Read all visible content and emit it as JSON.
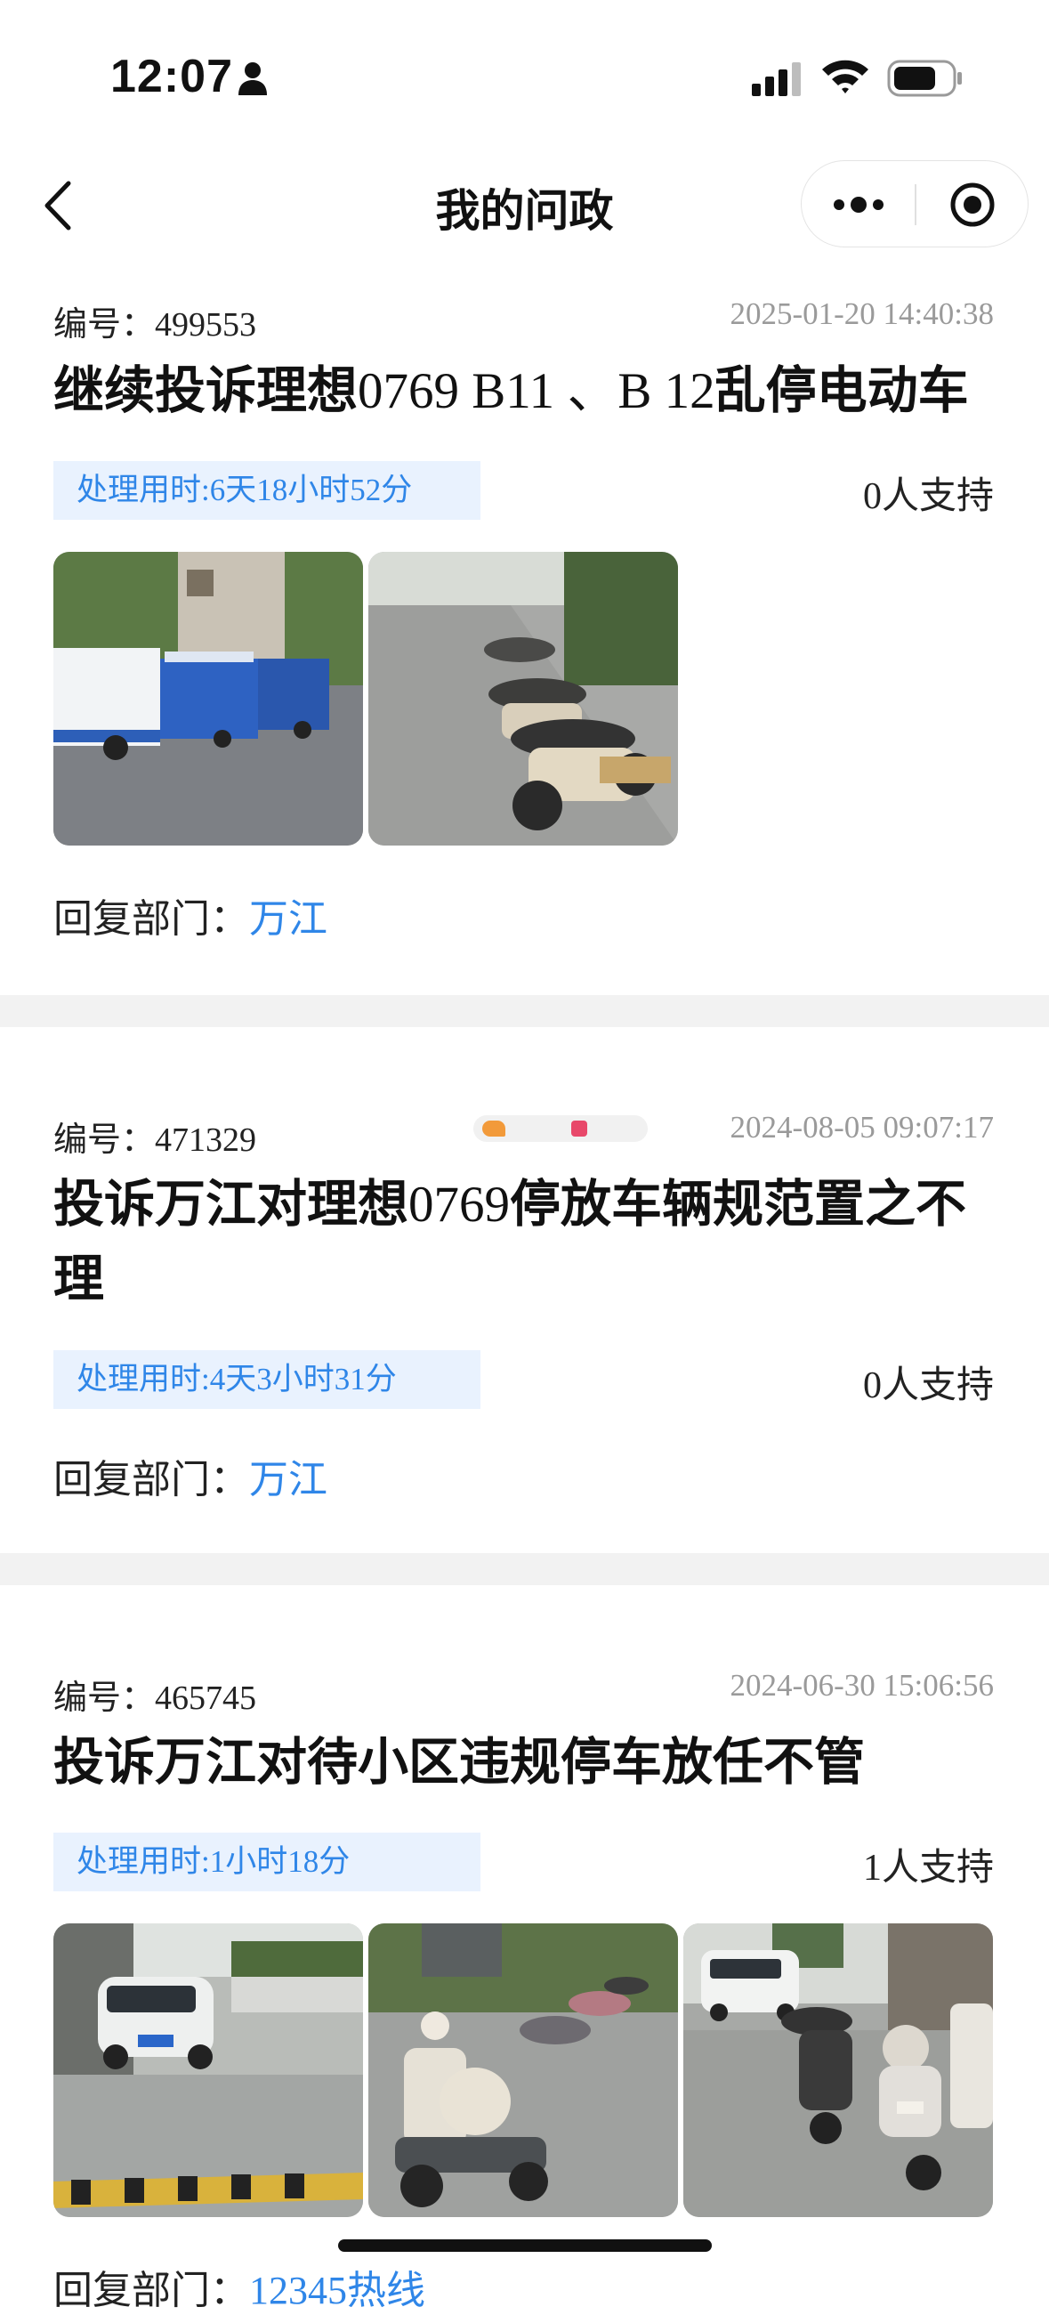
{
  "status_bar": {
    "time": "12:07"
  },
  "nav": {
    "title": "我的问政"
  },
  "colors": {
    "accent": "#2f86e8",
    "duration_bg": "#e9f2fe",
    "separator": "#f2f2f2"
  },
  "items": [
    {
      "number_label": "编号：",
      "number": "499553",
      "date": "2025-01-20 14:40:38",
      "title_parts": [
        "继续投诉理想",
        "0769 B11 、B 12",
        "乱停电动车"
      ],
      "duration": "处理用时:6天18小时52分",
      "support": "0人支持",
      "dept_label": "回复部门：",
      "dept": "万江",
      "photos": [
        "street-tricycles-photo",
        "parked-ebikes-photo"
      ]
    },
    {
      "number_label": "编号：",
      "number": "471329",
      "date": "2024-08-05 09:07:17",
      "title_parts": [
        "投诉万江对理想",
        "0769",
        "停放车辆规范置之不理"
      ],
      "duration": "处理用时:4天3小时31分",
      "support": "0人支持",
      "dept_label": "回复部门：",
      "dept": "万江",
      "photos": []
    },
    {
      "number_label": "编号：",
      "number": "465745",
      "date": "2024-06-30 15:06:56",
      "title_parts": [
        "投诉万江对待小区违规停车放任不管"
      ],
      "duration": "处理用时:1小时18分",
      "support": "1人支持",
      "dept_label": "回复部门：",
      "dept": "12345热线",
      "photos": [
        "parked-suv-photo",
        "scooters-row-photo",
        "car-and-scooters-photo"
      ]
    }
  ]
}
